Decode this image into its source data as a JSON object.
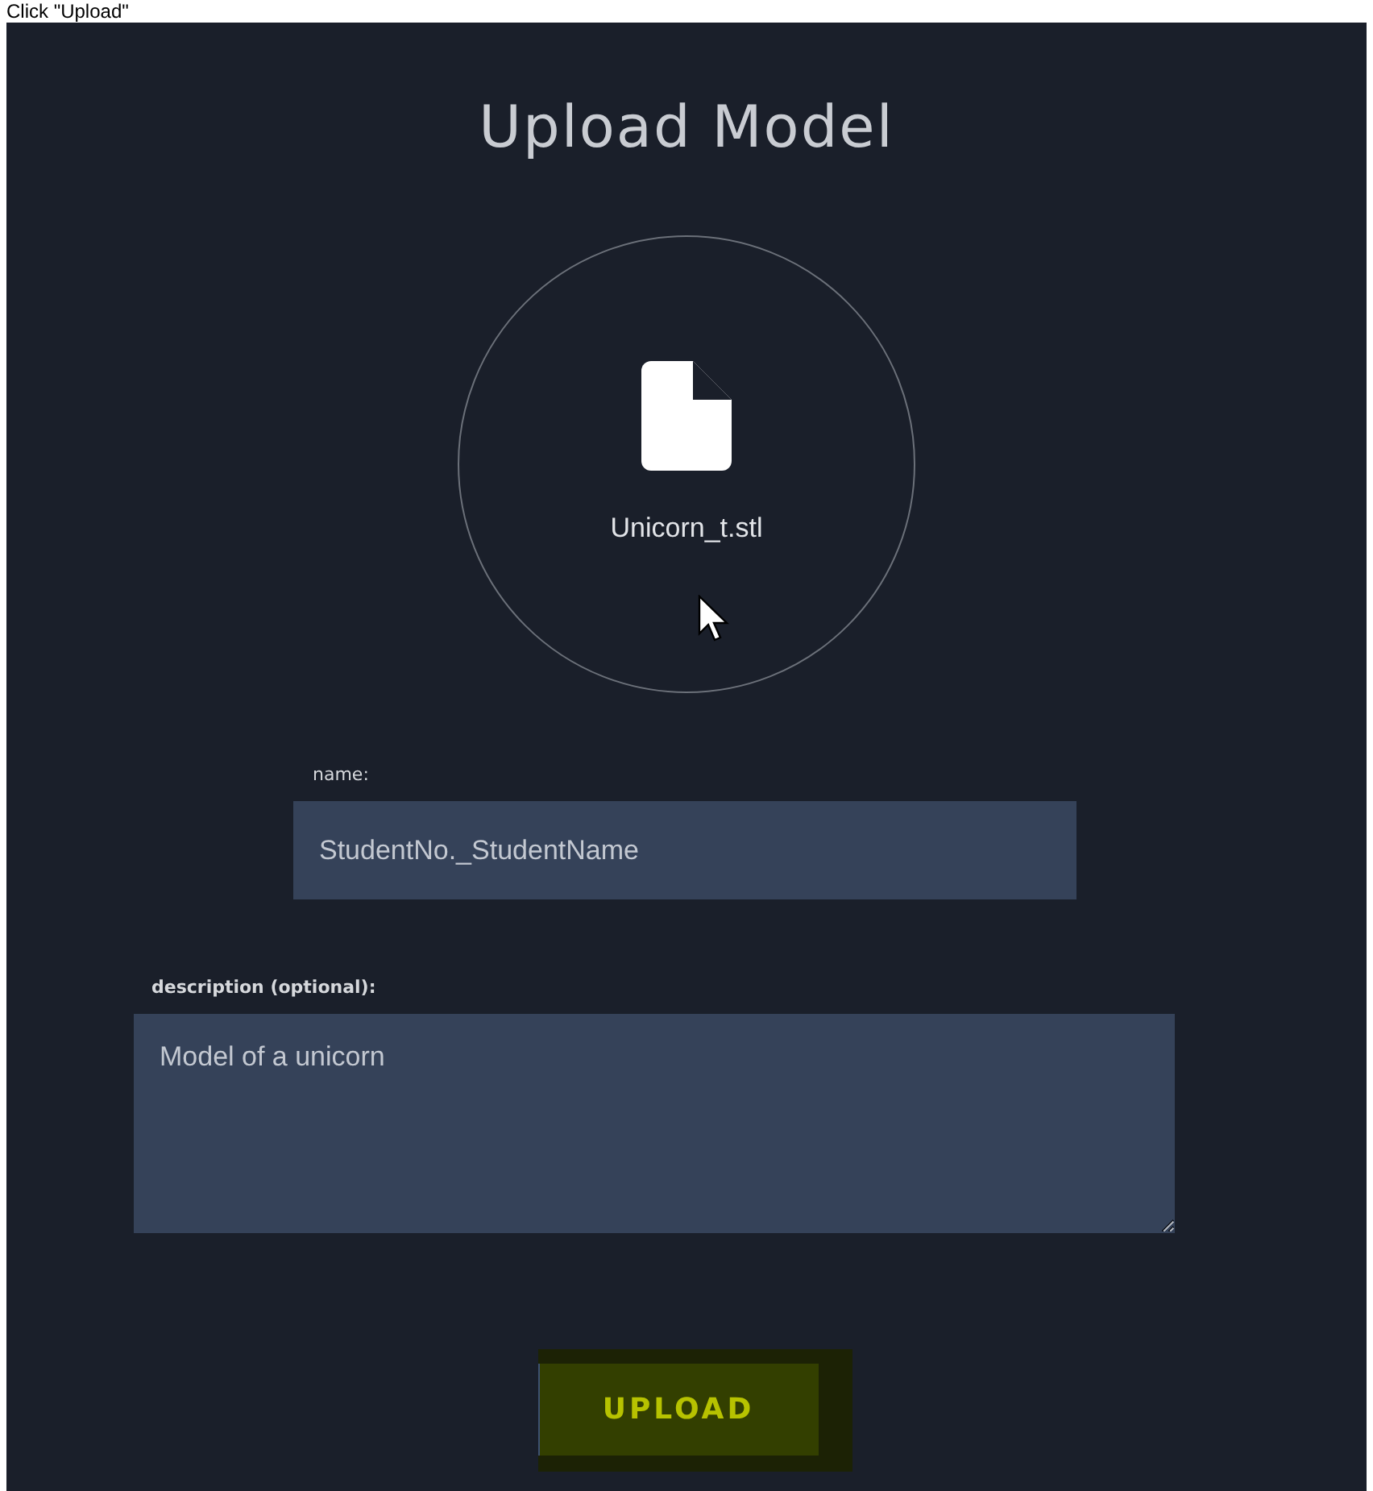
{
  "caption": "Click \"Upload\"",
  "title": "Upload Model",
  "file_drop": {
    "file_name": "Unicorn_t.stl"
  },
  "fields": [
    {
      "kind": "input",
      "label": "name:",
      "value": "StudentNo._StudentName"
    },
    {
      "kind": "textarea",
      "label": "description (optional):",
      "value": "Model of a unicorn"
    }
  ],
  "button": "UPLOAD"
}
